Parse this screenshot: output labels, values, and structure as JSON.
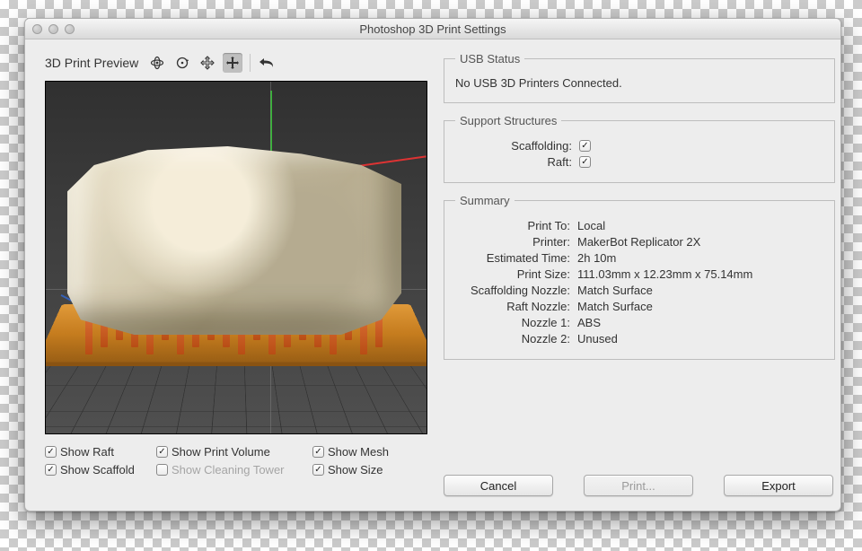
{
  "window": {
    "title": "Photoshop 3D Print Settings"
  },
  "preview": {
    "label": "3D Print Preview"
  },
  "view_options": {
    "show_raft": {
      "label": "Show Raft",
      "checked": true
    },
    "show_print_volume": {
      "label": "Show Print Volume",
      "checked": true
    },
    "show_mesh": {
      "label": "Show Mesh",
      "checked": true
    },
    "show_scaffold": {
      "label": "Show Scaffold",
      "checked": true
    },
    "show_cleaning_tower": {
      "label": "Show Cleaning Tower",
      "checked": false,
      "disabled": true
    },
    "show_size": {
      "label": "Show Size",
      "checked": true
    }
  },
  "usb_status": {
    "legend": "USB Status",
    "message": "No USB 3D Printers Connected."
  },
  "support_structures": {
    "legend": "Support Structures",
    "scaffolding": {
      "label": "Scaffolding:",
      "checked": true
    },
    "raft": {
      "label": "Raft:",
      "checked": true
    }
  },
  "summary": {
    "legend": "Summary",
    "rows": {
      "print_to": {
        "label": "Print To:",
        "value": "Local"
      },
      "printer": {
        "label": "Printer:",
        "value": "MakerBot Replicator 2X"
      },
      "estimated_time": {
        "label": "Estimated Time:",
        "value": "2h 10m"
      },
      "print_size": {
        "label": "Print Size:",
        "value": "111.03mm x 12.23mm x 75.14mm"
      },
      "scaffolding_nozzle": {
        "label": "Scaffolding Nozzle:",
        "value": "Match Surface"
      },
      "raft_nozzle": {
        "label": "Raft Nozzle:",
        "value": "Match Surface"
      },
      "nozzle_1": {
        "label": "Nozzle 1:",
        "value": "ABS"
      },
      "nozzle_2": {
        "label": "Nozzle 2:",
        "value": "Unused"
      }
    }
  },
  "actions": {
    "cancel": "Cancel",
    "print": "Print...",
    "export": "Export"
  },
  "toolbar_icons": {
    "orbit": "orbit-icon",
    "rotate": "rotate-icon",
    "pan": "pan-icon",
    "move": "move-icon",
    "undo": "undo-icon"
  }
}
